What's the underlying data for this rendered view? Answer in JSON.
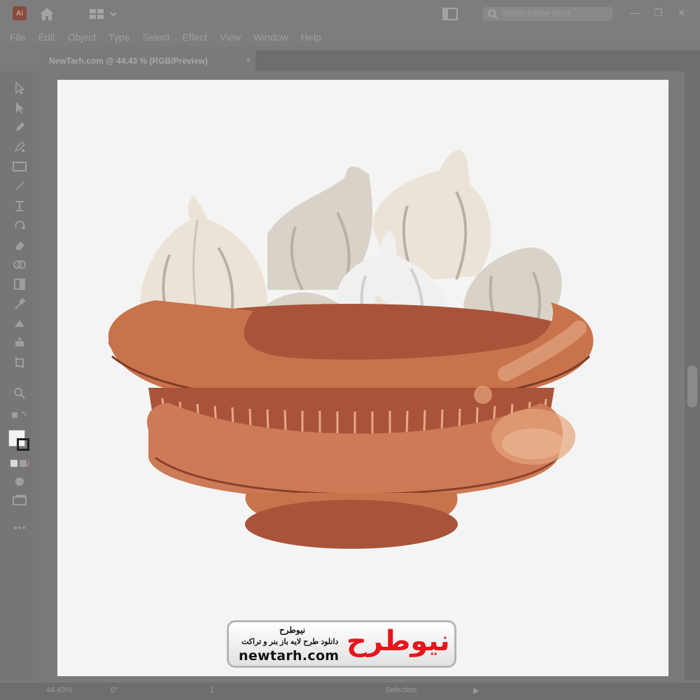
{
  "app": {
    "logo": "Ai"
  },
  "search": {
    "placeholder": "Search Adobe Stock"
  },
  "menu": [
    "File",
    "Edit",
    "Object",
    "Type",
    "Select",
    "Effect",
    "View",
    "Window",
    "Help"
  ],
  "document_tab": {
    "title": "NewTarh.com @ 44.43 % (RGB/Preview)",
    "close": "×"
  },
  "status": {
    "zoom": "44.43%",
    "rotation": "0°",
    "artboard": "1",
    "tool": "Selection"
  },
  "watermark": {
    "brand_fa": "نیوطرح",
    "tagline_fa": "دانلود طرح لایه باز بنر و تراکت",
    "domain": "newtarh.com",
    "mark_fa": "نیوطرح"
  },
  "illustration": {
    "subject": "bowl of garlic bulbs",
    "bowl_color": "#c8734c",
    "bowl_dark": "#a9543a",
    "garlic_light": "#ebe3d7",
    "garlic_gray": "#d8d2c8",
    "garlic_white": "#f0f0f0"
  }
}
